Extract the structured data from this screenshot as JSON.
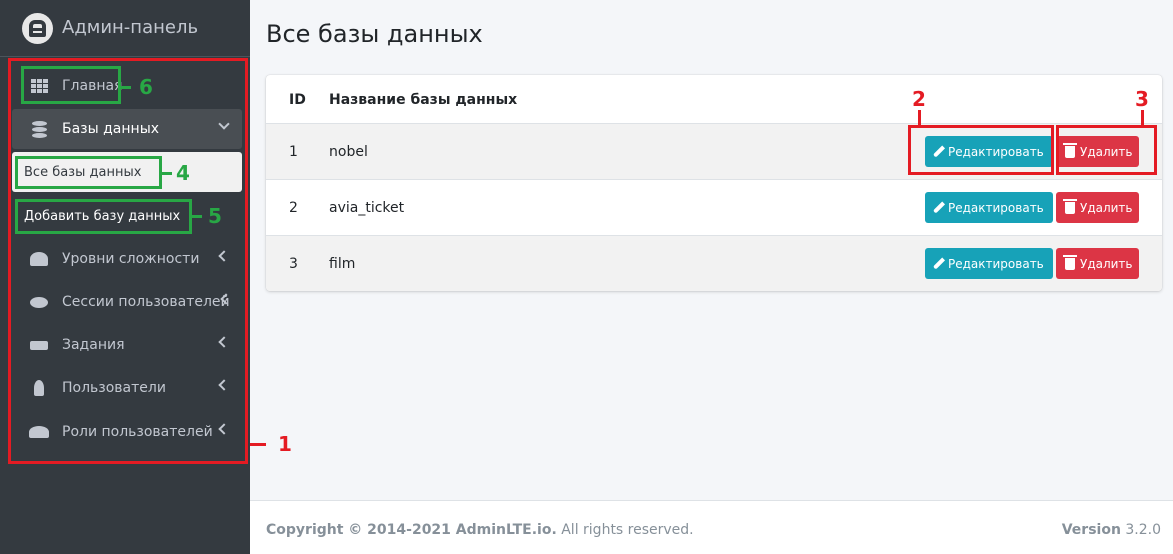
{
  "brand": {
    "title": "Админ-панель"
  },
  "sidebar": {
    "items": [
      {
        "label": "Главная"
      },
      {
        "label": "Базы данных"
      },
      {
        "label": "Все базы данных"
      },
      {
        "label": "Добавить базу данных"
      },
      {
        "label": "Уровни сложности"
      },
      {
        "label": "Сессии пользователей"
      },
      {
        "label": "Задания"
      },
      {
        "label": "Пользователи"
      },
      {
        "label": "Роли пользователей"
      }
    ]
  },
  "page": {
    "title": "Все базы данных"
  },
  "table": {
    "headers": [
      "ID",
      "Название базы данных"
    ],
    "rows": [
      {
        "id": "1",
        "name": "nobel"
      },
      {
        "id": "2",
        "name": "avia_ticket"
      },
      {
        "id": "3",
        "name": "film"
      }
    ],
    "edit_label": "Редактировать",
    "delete_label": "Удалить"
  },
  "annotations": [
    "1",
    "2",
    "3",
    "4",
    "5",
    "6"
  ],
  "footer": {
    "copyright": "Copyright © 2014-2021 AdminLTE.io.",
    "rights": " All rights reserved.",
    "version_label": "Version",
    "version": " 3.2.0"
  },
  "colors": {
    "sidebar_bg": "#343a40",
    "edit_button": "#17a2b8",
    "delete_button": "#dc3545",
    "annotation_red": "#e41b23",
    "annotation_green": "#28a745"
  }
}
